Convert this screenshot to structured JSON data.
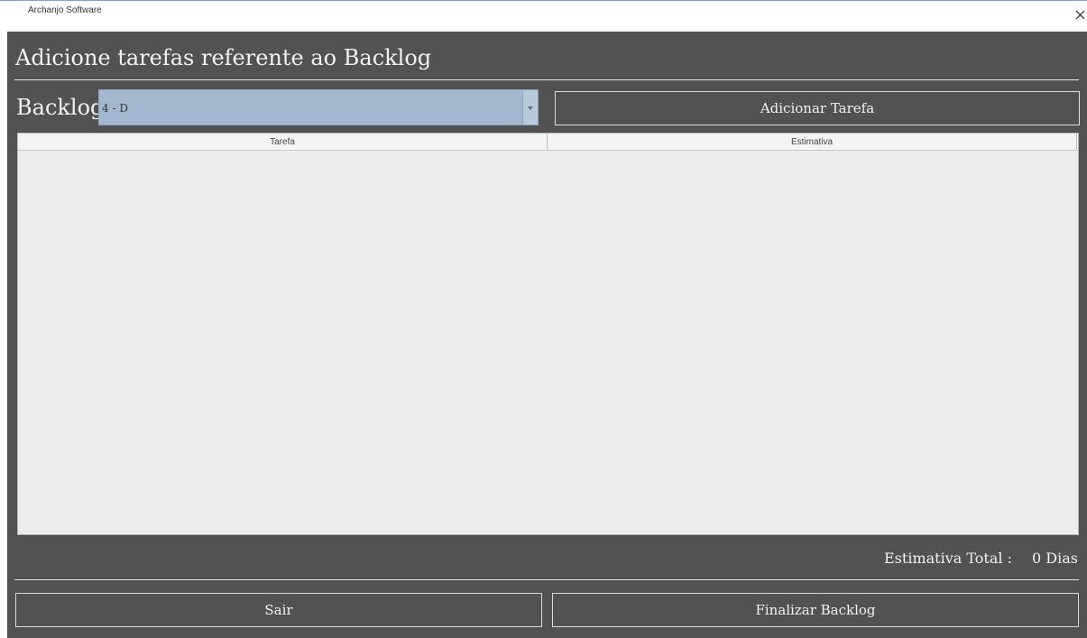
{
  "window": {
    "title": "Archanjo Software",
    "close_icon": "close-icon"
  },
  "header": {
    "title": "Adicione tarefas referente ao Backlog"
  },
  "backlog": {
    "label": "Backlog",
    "selected": "4 - D"
  },
  "toolbar": {
    "add_task_label": "Adicionar Tarefa"
  },
  "table": {
    "columns": [
      "Tarefa",
      "Estimativa"
    ],
    "rows": []
  },
  "summary": {
    "label": "Estimativa Total :",
    "value": "0 Dias"
  },
  "footer": {
    "exit_label": "Sair",
    "finish_label": "Finalizar Backlog"
  },
  "colors": {
    "background": "#525252",
    "text": "#f2f2f2",
    "combo": "#a3b8cf",
    "table": "#ececec"
  }
}
